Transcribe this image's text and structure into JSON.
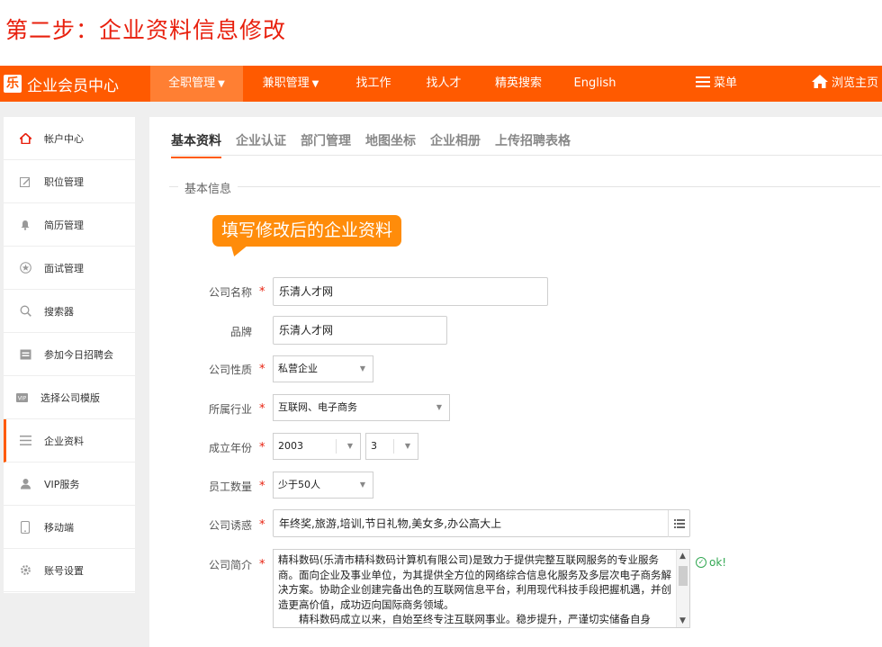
{
  "step_title": "第二步：企业资料信息修改",
  "brand": {
    "logo_char": "乐",
    "name": "企业会员中心"
  },
  "nav": [
    {
      "label": "全职管理",
      "caret": "⌄",
      "active": true
    },
    {
      "label": "兼职管理",
      "caret": "⌄",
      "active": false
    },
    {
      "label": "找工作",
      "active": false
    },
    {
      "label": "找人才",
      "active": false
    },
    {
      "label": "精英搜索",
      "active": false
    },
    {
      "label": "English",
      "active": false
    },
    {
      "label": "菜单",
      "icon": "menu-icon"
    },
    {
      "label": "浏览主页",
      "icon": "home-icon"
    }
  ],
  "sidebar": {
    "items": [
      {
        "label": "帐户中心",
        "icon": "home-icon"
      },
      {
        "label": "职位管理",
        "icon": "edit-icon"
      },
      {
        "label": "简历管理",
        "icon": "bell-icon"
      },
      {
        "label": "面试管理",
        "icon": "star-icon"
      },
      {
        "label": "搜索器",
        "icon": "search-icon"
      },
      {
        "label": "参加今日招聘会",
        "icon": "calendar-icon"
      },
      {
        "label": "选择公司模版",
        "icon": "vip-icon"
      },
      {
        "label": "企业资料",
        "icon": "list-icon",
        "active": true
      },
      {
        "label": "VIP服务",
        "icon": "user-icon"
      },
      {
        "label": "移动端",
        "icon": "mobile-icon"
      },
      {
        "label": "账号设置",
        "icon": "gear-icon"
      }
    ]
  },
  "tabs": [
    "基本资料",
    "企业认证",
    "部门管理",
    "地图坐标",
    "企业相册",
    "上传招聘表格"
  ],
  "active_tab": 0,
  "section_title": "基本信息",
  "tooltip": "填写修改后的企业资料",
  "form": {
    "required_mark": "*",
    "company_name": {
      "label": "公司名称",
      "value": "乐清人才网",
      "required": true
    },
    "brand": {
      "label": "品牌",
      "value": "乐清人才网",
      "required": false
    },
    "nature": {
      "label": "公司性质",
      "value": "私营企业",
      "required": true
    },
    "industry": {
      "label": "所属行业",
      "value": "互联网、电子商务",
      "required": true
    },
    "founded": {
      "label": "成立年份",
      "year": "2003",
      "month": "3",
      "required": true
    },
    "staff": {
      "label": "员工数量",
      "value": "少于50人",
      "required": true
    },
    "benefits": {
      "label": "公司诱惑",
      "value": "年终奖,旅游,培训,节日礼物,美女多,办公高大上",
      "required": true
    },
    "intro": {
      "label": "公司简介",
      "required": true,
      "paragraph1": "精科数码(乐清市精科数码计算机有限公司)是致力于提供完整互联网服务的专业服务商。面向企业及事业单位，为其提供全方位的网络综合信息化服务及多层次电子商务解决方案。协助企业创建完备出色的互联网信息平台，利用现代科技手段把握机遇，并创造更高价值，成功迈向国际商务领域。",
      "paragraph2": "　　精科数码成立以来，自始至终专注互联网事业。稳步提升，严谨切实储备自身",
      "ok_text": "ok!"
    }
  },
  "colors": {
    "brand_orange": "#ff5a00",
    "title_red": "#e8200e",
    "tooltip_orange": "#ff8c0a",
    "ok_green": "#33a853"
  }
}
